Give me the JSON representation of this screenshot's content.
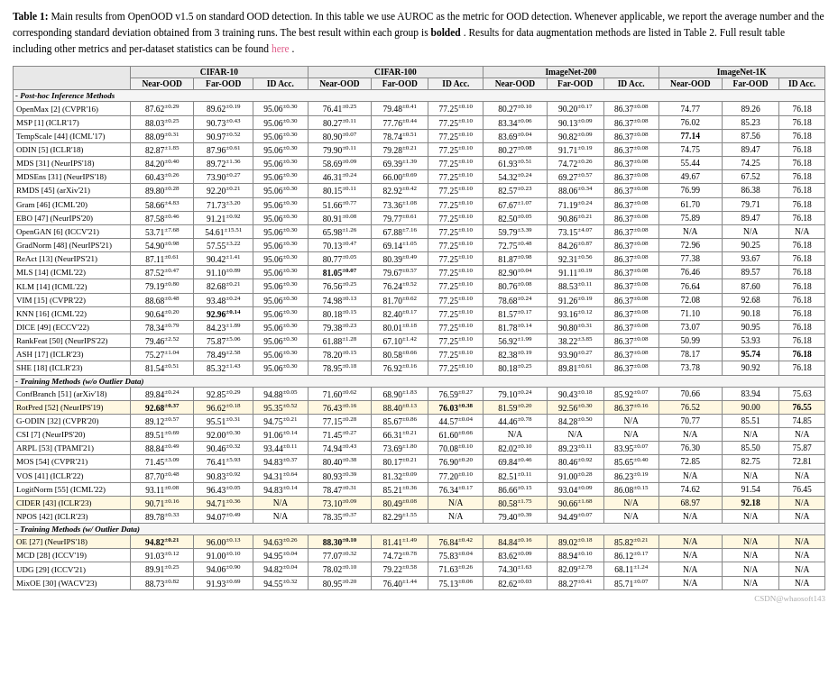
{
  "caption": {
    "label": "Table 1:",
    "text1": " Main results from OpenOOD v1.5 on standard OOD detection. In this table we use AUROC as the metric for OOD detection.  Whenever applicable, we report the average number and the corresponding standard deviation obtained from 3 training runs. The best result within each group is ",
    "bold": "bolded",
    "text2": ". Results for data augmentation methods are listed in Table 2. Full result table including other metrics and per-dataset statistics can be found ",
    "link": "here",
    "text3": "."
  },
  "table": {
    "col_groups": [
      {
        "label": "",
        "span": 1
      },
      {
        "label": "CIFAR-10",
        "span": 3
      },
      {
        "label": "CIFAR-100",
        "span": 3
      },
      {
        "label": "ImageNet-200",
        "span": 3
      },
      {
        "label": "ImageNet-1K",
        "span": 3
      }
    ],
    "sub_headers": [
      "Near-OOD",
      "Far-OOD",
      "ID Acc.",
      "Near-OOD",
      "Far-OOD",
      "ID Acc.",
      "Near-OOD",
      "Far-OOD",
      "ID Acc.",
      "Near-OOD",
      "Far-OOD",
      "ID Acc."
    ],
    "sections": [
      {
        "section_label": "- Post-hoc Inference Methods",
        "rows": [
          {
            "method": "OpenMax [2] (CVPR'16)",
            "vals": [
              "87.62±0.29",
              "89.62±0.19",
              "95.06±0.30",
              "76.41±0.25",
              "79.48±0.41",
              "77.25±0.10",
              "80.27±0.10",
              "90.20±0.17",
              "86.37±0.08",
              "74.77",
              "89.26",
              "76.18"
            ],
            "bold": []
          },
          {
            "method": "MSP [1] (ICLR'17)",
            "vals": [
              "88.03±0.25",
              "90.73±0.43",
              "95.06±0.30",
              "80.27±0.11",
              "77.76±0.44",
              "77.25±0.10",
              "83.34±0.06",
              "90.13±0.09",
              "86.37±0.08",
              "76.02",
              "85.23",
              "76.18"
            ],
            "bold": []
          },
          {
            "method": "TempScale [44] (ICML'17)",
            "vals": [
              "88.09±0.31",
              "90.97±0.52",
              "95.06±0.30",
              "80.90±0.07",
              "78.74±0.51",
              "77.25±0.10",
              "83.69±0.04",
              "90.82±0.09",
              "86.37±0.08",
              "77.14",
              "87.56",
              "76.18"
            ],
            "bold": [
              9
            ]
          },
          {
            "method": "ODIN [5] (ICLR'18)",
            "vals": [
              "82.87±1.85",
              "87.96±0.61",
              "95.06±0.30",
              "79.90±0.11",
              "79.28±0.21",
              "77.25±0.10",
              "80.27±0.08",
              "91.71±0.19",
              "86.37±0.08",
              "74.75",
              "89.47",
              "76.18"
            ],
            "bold": []
          },
          {
            "method": "MDS [31] (NeurIPS'18)",
            "vals": [
              "84.20±0.40",
              "89.72±1.36",
              "95.06±0.30",
              "58.69±0.09",
              "69.39±1.39",
              "77.25±0.10",
              "61.93±0.51",
              "74.72±0.26",
              "86.37±0.08",
              "55.44",
              "74.25",
              "76.18"
            ],
            "bold": []
          },
          {
            "method": "MDSEns [31] (NeurIPS'18)",
            "vals": [
              "60.43±0.26",
              "73.90±0.27",
              "95.06±0.30",
              "46.31±0.24",
              "66.00±0.69",
              "77.25±0.10",
              "54.32±0.24",
              "69.27±0.57",
              "86.37±0.08",
              "49.67",
              "67.52",
              "76.18"
            ],
            "bold": []
          },
          {
            "method": "RMDS [45] (arXiv'21)",
            "vals": [
              "89.80±0.28",
              "92.20±0.21",
              "95.06±0.30",
              "80.15±0.11",
              "82.92±0.42",
              "77.25±0.10",
              "82.57±0.23",
              "88.06±0.34",
              "86.37±0.08",
              "76.99",
              "86.38",
              "76.18"
            ],
            "bold": []
          },
          {
            "method": "Gram [46] (ICML'20)",
            "vals": [
              "58.66±4.83",
              "71.73±3.20",
              "95.06±0.30",
              "51.66±0.77",
              "73.36±1.08",
              "77.25±0.10",
              "67.67±1.07",
              "71.19±0.24",
              "86.37±0.08",
              "61.70",
              "79.71",
              "76.18"
            ],
            "bold": []
          },
          {
            "method": "EBO [47] (NeurIPS'20)",
            "vals": [
              "87.58±0.46",
              "91.21±0.92",
              "95.06±0.30",
              "80.91±0.08",
              "79.77±0.61",
              "77.25±0.10",
              "82.50±0.05",
              "90.86±0.21",
              "86.37±0.08",
              "75.89",
              "89.47",
              "76.18"
            ],
            "bold": []
          },
          {
            "method": "OpenGAN [6] (ICCV'21)",
            "vals": [
              "53.71±7.68",
              "54.61±15.51",
              "95.06±0.30",
              "65.98±1.26",
              "67.88±7.16",
              "77.25±0.10",
              "59.79±3.39",
              "73.15±4.07",
              "86.37±0.08",
              "N/A",
              "N/A",
              "N/A"
            ],
            "bold": []
          },
          {
            "method": "GradNorm [48] (NeurIPS'21)",
            "vals": [
              "54.90±0.98",
              "57.55±3.22",
              "95.06±0.30",
              "70.13±0.47",
              "69.14±1.05",
              "77.25±0.10",
              "72.75±0.48",
              "84.26±0.87",
              "86.37±0.08",
              "72.96",
              "90.25",
              "76.18"
            ],
            "bold": []
          },
          {
            "method": "ReAct [13] (NeurIPS'21)",
            "vals": [
              "87.11±0.61",
              "90.42±1.41",
              "95.06±0.30",
              "80.77±0.05",
              "80.39±0.49",
              "77.25±0.10",
              "81.87±0.98",
              "92.31±0.56",
              "86.37±0.08",
              "77.38",
              "93.67",
              "76.18"
            ],
            "bold": []
          },
          {
            "method": "MLS [14] (ICML'22)",
            "vals": [
              "87.52±0.47",
              "91.10±0.89",
              "95.06±0.30",
              "81.05±0.07",
              "79.67±0.57",
              "77.25±0.10",
              "82.90±0.04",
              "91.11±0.19",
              "86.37±0.08",
              "76.46",
              "89.57",
              "76.18"
            ],
            "bold": [
              3
            ]
          },
          {
            "method": "KLM [14] (ICML'22)",
            "vals": [
              "79.19±0.80",
              "82.68±0.21",
              "95.06±0.30",
              "76.56±0.25",
              "76.24±0.52",
              "77.25±0.10",
              "80.76±0.08",
              "88.53±0.11",
              "86.37±0.08",
              "76.64",
              "87.60",
              "76.18"
            ],
            "bold": []
          },
          {
            "method": "VIM [15] (CVPR'22)",
            "vals": [
              "88.68±0.48",
              "93.48±0.24",
              "95.06±0.30",
              "74.98±0.13",
              "81.70±0.62",
              "77.25±0.10",
              "78.68±0.24",
              "91.26±0.19",
              "86.37±0.08",
              "72.08",
              "92.68",
              "76.18"
            ],
            "bold": []
          },
          {
            "method": "KNN [16] (ICML'22)",
            "vals": [
              "90.64±0.20",
              "92.96±0.14",
              "95.06±0.30",
              "80.18±0.15",
              "82.40±0.17",
              "77.25±0.10",
              "81.57±0.17",
              "93.16±0.12",
              "86.37±0.08",
              "71.10",
              "90.18",
              "76.18"
            ],
            "bold": [
              1
            ]
          },
          {
            "method": "DICE [49] (ECCV'22)",
            "vals": [
              "78.34±0.79",
              "84.23±1.89",
              "95.06±0.30",
              "79.38±0.23",
              "80.01±0.18",
              "77.25±0.10",
              "81.78±0.14",
              "90.80±0.31",
              "86.37±0.08",
              "73.07",
              "90.95",
              "76.18"
            ],
            "bold": []
          },
          {
            "method": "RankFeat [50] (NeurIPS'22)",
            "vals": [
              "79.46±2.52",
              "75.87±5.06",
              "95.06±0.30",
              "61.88±1.28",
              "67.10±1.42",
              "77.25±0.10",
              "56.92±1.99",
              "38.22±3.85",
              "86.37±0.08",
              "50.99",
              "53.93",
              "76.18"
            ],
            "bold": []
          },
          {
            "method": "ASH [17] (ICLR'23)",
            "vals": [
              "75.27±1.04",
              "78.49±2.58",
              "95.06±0.30",
              "78.20±0.15",
              "80.58±0.66",
              "77.25±0.10",
              "82.38±0.19",
              "93.90±0.27",
              "86.37±0.08",
              "78.17",
              "95.74",
              "76.18"
            ],
            "bold": [
              10,
              11
            ]
          },
          {
            "method": "SHE [18] (ICLR'23)",
            "vals": [
              "81.54±0.51",
              "85.32±1.43",
              "95.06±0.30",
              "78.95±0.18",
              "76.92±0.16",
              "77.25±0.10",
              "80.18±0.25",
              "89.81±0.61",
              "86.37±0.08",
              "73.78",
              "90.92",
              "76.18"
            ],
            "bold": []
          }
        ]
      },
      {
        "section_label": "- Training Methods (w/o Outlier Data)",
        "rows": [
          {
            "method": "ConfBranch [51] (arXiv'18)",
            "vals": [
              "89.84±0.24",
              "92.85±0.29",
              "94.88±0.05",
              "71.60±0.62",
              "68.90±1.83",
              "76.59±0.27",
              "79.10±0.24",
              "90.43±0.18",
              "85.92±0.07",
              "70.66",
              "83.94",
              "75.63"
            ],
            "bold": []
          },
          {
            "method": "RotPred [52] (NeurIPS'19)",
            "vals": [
              "92.68±0.37",
              "96.62±0.18",
              "95.35±0.52",
              "76.43±0.16",
              "88.40±0.13",
              "76.03±0.38",
              "81.59±0.20",
              "92.56±0.30",
              "86.37±0.16",
              "76.52",
              "90.00",
              "76.55"
            ],
            "bold": [
              0,
              5,
              11
            ],
            "highlighted": true
          },
          {
            "method": "G-ODIN [32] (CVPR'20)",
            "vals": [
              "89.12±0.57",
              "95.51±0.31",
              "94.75±0.21",
              "77.15±0.28",
              "85.67±0.86",
              "44.57±0.04",
              "44.46±0.78",
              "84.28±0.50",
              "N/A",
              "70.77",
              "85.51",
              "74.85"
            ],
            "bold": []
          },
          {
            "method": "CSI [7] (NeurIPS'20)",
            "vals": [
              "89.51±0.69",
              "92.00±0.30",
              "91.06±0.14",
              "71.45±0.27",
              "66.31±0.21",
              "61.60±0.66",
              "N/A",
              "N/A",
              "N/A",
              "N/A",
              "N/A",
              "N/A"
            ],
            "bold": []
          },
          {
            "method": "ARPL [53] (TPAMI'21)",
            "vals": [
              "88.84±0.49",
              "90.46±0.32",
              "93.44±0.11",
              "74.94±0.43",
              "73.69±1.80",
              "70.08±0.10",
              "82.02±0.10",
              "89.23±0.11",
              "83.95±0.07",
              "76.30",
              "85.50",
              "75.87"
            ],
            "bold": []
          },
          {
            "method": "MOS [54] (CVPR'21)",
            "vals": [
              "71.45±3.09",
              "76.41±5.93",
              "94.83±0.37",
              "80.40±0.38",
              "80.17±0.21",
              "76.90±0.20",
              "69.84±0.46",
              "80.46±0.92",
              "85.65±0.40",
              "72.85",
              "82.75",
              "72.81"
            ],
            "bold": []
          },
          {
            "method": "VOS [41] (ICLR'22)",
            "vals": [
              "87.70±0.48",
              "90.83±0.92",
              "94.31±0.64",
              "80.93±0.39",
              "81.32±0.09",
              "77.20±0.10",
              "82.51±0.11",
              "91.00±0.28",
              "86.23±0.19",
              "N/A",
              "N/A",
              "N/A"
            ],
            "bold": []
          },
          {
            "method": "LogitNorm [55] (ICML'22)",
            "vals": [
              "93.11±0.08",
              "96.43±0.05",
              "94.83±0.14",
              "78.47±0.31",
              "85.21±0.36",
              "76.34±0.17",
              "86.66±0.15",
              "93.04±0.09",
              "86.08±0.15",
              "74.62",
              "91.54",
              "76.45"
            ],
            "bold": []
          },
          {
            "method": "CIDER [43] (ICLR'23)",
            "vals": [
              "90.71±0.16",
              "94.71±0.36",
              "N/A",
              "73.10±0.09",
              "80.49±0.08",
              "N/A",
              "80.58±1.75",
              "90.66±1.68",
              "N/A",
              "68.97",
              "92.18",
              "N/A"
            ],
            "bold": [
              10
            ],
            "highlighted": true
          },
          {
            "method": "NPOS [42] (ICLR'23)",
            "vals": [
              "89.78±0.33",
              "94.07±0.49",
              "N/A",
              "78.35±0.37",
              "82.29±1.55",
              "N/A",
              "79.40±0.39",
              "94.49±0.07",
              "N/A",
              "N/A",
              "N/A",
              "N/A"
            ],
            "bold": []
          }
        ]
      },
      {
        "section_label": "- Training Methods (w/ Outlier Data)",
        "rows": [
          {
            "method": "OE [27] (NeurIPS'18)",
            "vals": [
              "94.82±0.21",
              "96.00±0.13",
              "94.63±0.26",
              "88.30±0.10",
              "81.41±1.49",
              "76.84±0.42",
              "84.84±0.16",
              "89.02±0.18",
              "85.82±0.21",
              "N/A",
              "N/A",
              "N/A"
            ],
            "bold": [
              0,
              3
            ],
            "highlighted": true
          },
          {
            "method": "MCD [28] (ICCV'19)",
            "vals": [
              "91.03±0.12",
              "91.00±0.10",
              "94.95±0.04",
              "77.07±0.32",
              "74.72±0.78",
              "75.83±0.04",
              "83.62±0.09",
              "88.94±0.10",
              "86.12±0.17",
              "N/A",
              "N/A",
              "N/A"
            ],
            "bold": []
          },
          {
            "method": "UDG [29] (ICCV'21)",
            "vals": [
              "89.91±0.25",
              "94.06±0.90",
              "94.82±0.04",
              "78.02±0.10",
              "79.22±0.58",
              "71.63±0.26",
              "74.30±1.63",
              "82.09±2.78",
              "68.11±1.24",
              "N/A",
              "N/A",
              "N/A"
            ],
            "bold": []
          },
          {
            "method": "MixOE [30] (WACV'23)",
            "vals": [
              "88.73±0.82",
              "91.93±0.69",
              "94.55±0.32",
              "80.95±0.20",
              "76.40±1.44",
              "75.13±0.06",
              "82.62±0.03",
              "88.27±0.41",
              "85.71±0.07",
              "N/A",
              "N/A",
              "N/A"
            ],
            "bold": []
          }
        ]
      }
    ]
  },
  "watermark": "CSDN@whaosoft143"
}
